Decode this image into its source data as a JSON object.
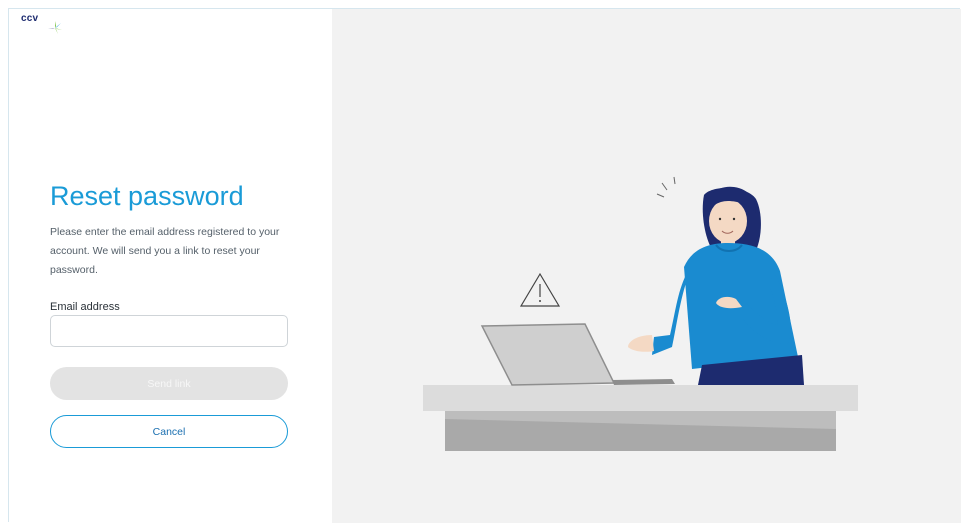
{
  "brand": {
    "logo_text": "ccv"
  },
  "form": {
    "title": "Reset password",
    "description": "Please enter the email address registered to your account. We will send you a link to reset your password.",
    "email_label": "Email address",
    "email_value": "",
    "email_placeholder": "",
    "send_label": "Send link",
    "cancel_label": "Cancel"
  },
  "colors": {
    "accent": "#1a9bd7",
    "navy": "#1d2b6f",
    "panel_bg": "#f2f2f2",
    "disabled_button": "#e3e3e3"
  },
  "icons": [
    "ccv-logo-icon",
    "warning-triangle-icon"
  ]
}
